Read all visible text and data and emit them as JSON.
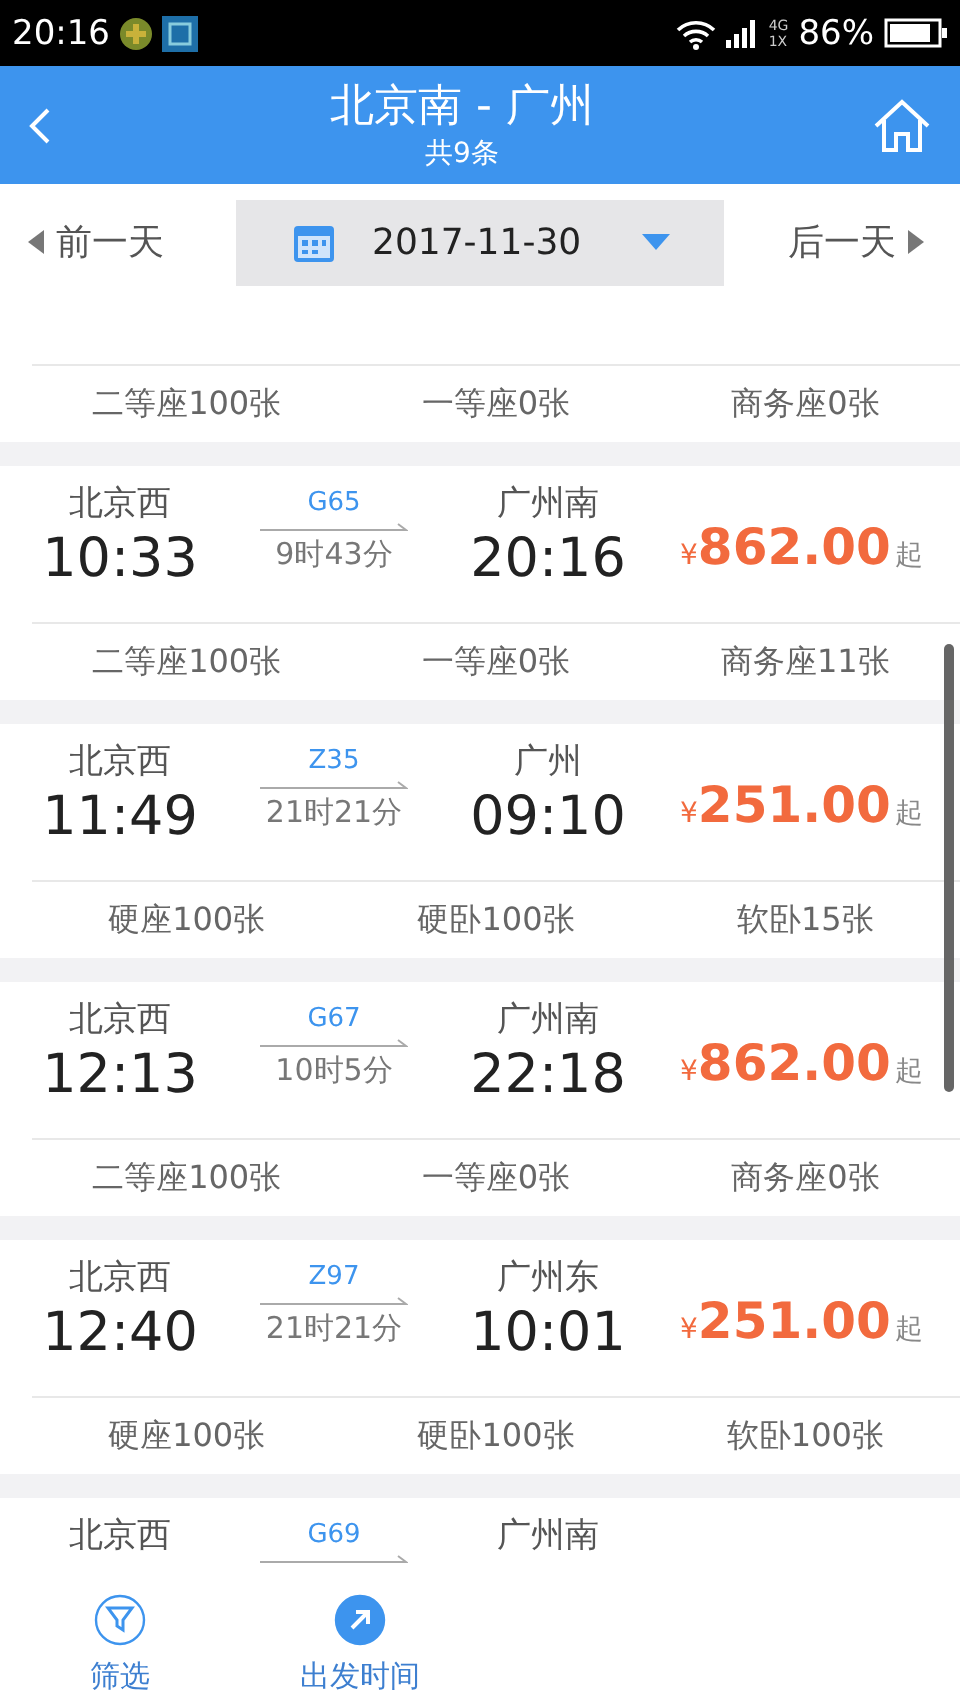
{
  "status_bar": {
    "time": "20:16",
    "network": [
      "4G",
      "1X"
    ],
    "battery": "86%"
  },
  "header": {
    "title": "北京南 - 广州",
    "subtitle": "共9条"
  },
  "date_bar": {
    "prev": "前一天",
    "date": "2017-11-30",
    "next": "后一天"
  },
  "trains": [
    {
      "seats": [
        "二等座100张",
        "一等座0张",
        "商务座0张"
      ]
    },
    {
      "from": "北京西",
      "depart": "10:33",
      "train": "G65",
      "duration": "9时43分",
      "to": "广州南",
      "arrive": "20:16",
      "currency": "¥",
      "price": "862.00",
      "suffix": "起",
      "seats": [
        "二等座100张",
        "一等座0张",
        "商务座11张"
      ]
    },
    {
      "from": "北京西",
      "depart": "11:49",
      "train": "Z35",
      "duration": "21时21分",
      "to": "广州",
      "arrive": "09:10",
      "currency": "¥",
      "price": "251.00",
      "suffix": "起",
      "seats": [
        "硬座100张",
        "硬卧100张",
        "软卧15张"
      ]
    },
    {
      "from": "北京西",
      "depart": "12:13",
      "train": "G67",
      "duration": "10时5分",
      "to": "广州南",
      "arrive": "22:18",
      "currency": "¥",
      "price": "862.00",
      "suffix": "起",
      "seats": [
        "二等座100张",
        "一等座0张",
        "商务座0张"
      ]
    },
    {
      "from": "北京西",
      "depart": "12:40",
      "train": "Z97",
      "duration": "21时21分",
      "to": "广州东",
      "arrive": "10:01",
      "currency": "¥",
      "price": "251.00",
      "suffix": "起",
      "seats": [
        "硬座100张",
        "硬卧100张",
        "软卧100张"
      ]
    },
    {
      "from": "北京西",
      "train": "G69",
      "to": "广州南"
    }
  ],
  "bottom_tabs": [
    {
      "label": "筛选",
      "kind": "filter",
      "selected": false
    },
    {
      "label": "出发时间",
      "kind": "depart",
      "selected": true
    }
  ]
}
